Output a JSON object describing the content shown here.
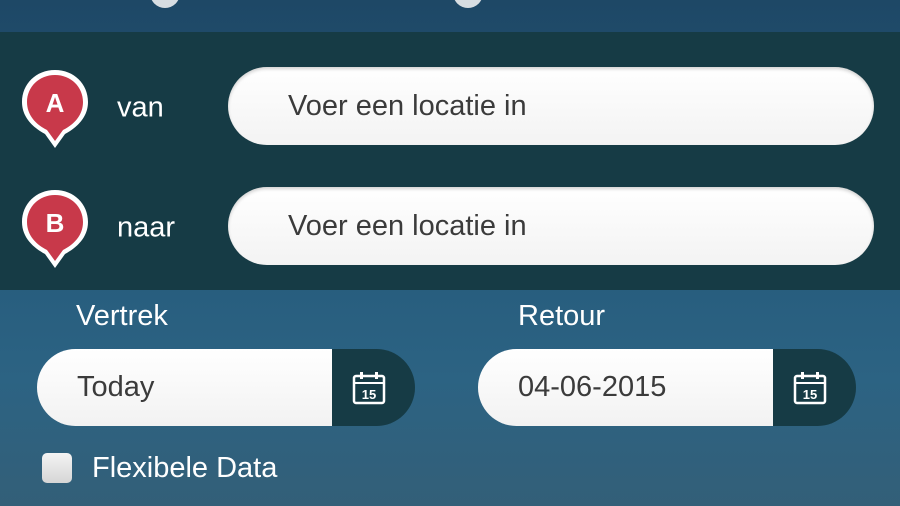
{
  "locations": {
    "from": {
      "marker": "A",
      "label": "van",
      "placeholder": "Voer een locatie in"
    },
    "to": {
      "marker": "B",
      "label": "naar",
      "placeholder": "Voer een locatie in"
    }
  },
  "dates": {
    "departure": {
      "label": "Vertrek",
      "value": "Today",
      "calendar_day": "15"
    },
    "return": {
      "label": "Retour",
      "value": "04-06-2015",
      "calendar_day": "15"
    }
  },
  "flexible": {
    "label": "Flexibele Data",
    "checked": false
  },
  "colors": {
    "marker_red": "#c8394a",
    "panel_dark": "#163b45",
    "background": "#24597a"
  },
  "icons": [
    "map-pin-icon",
    "calendar-icon",
    "checkbox"
  ]
}
